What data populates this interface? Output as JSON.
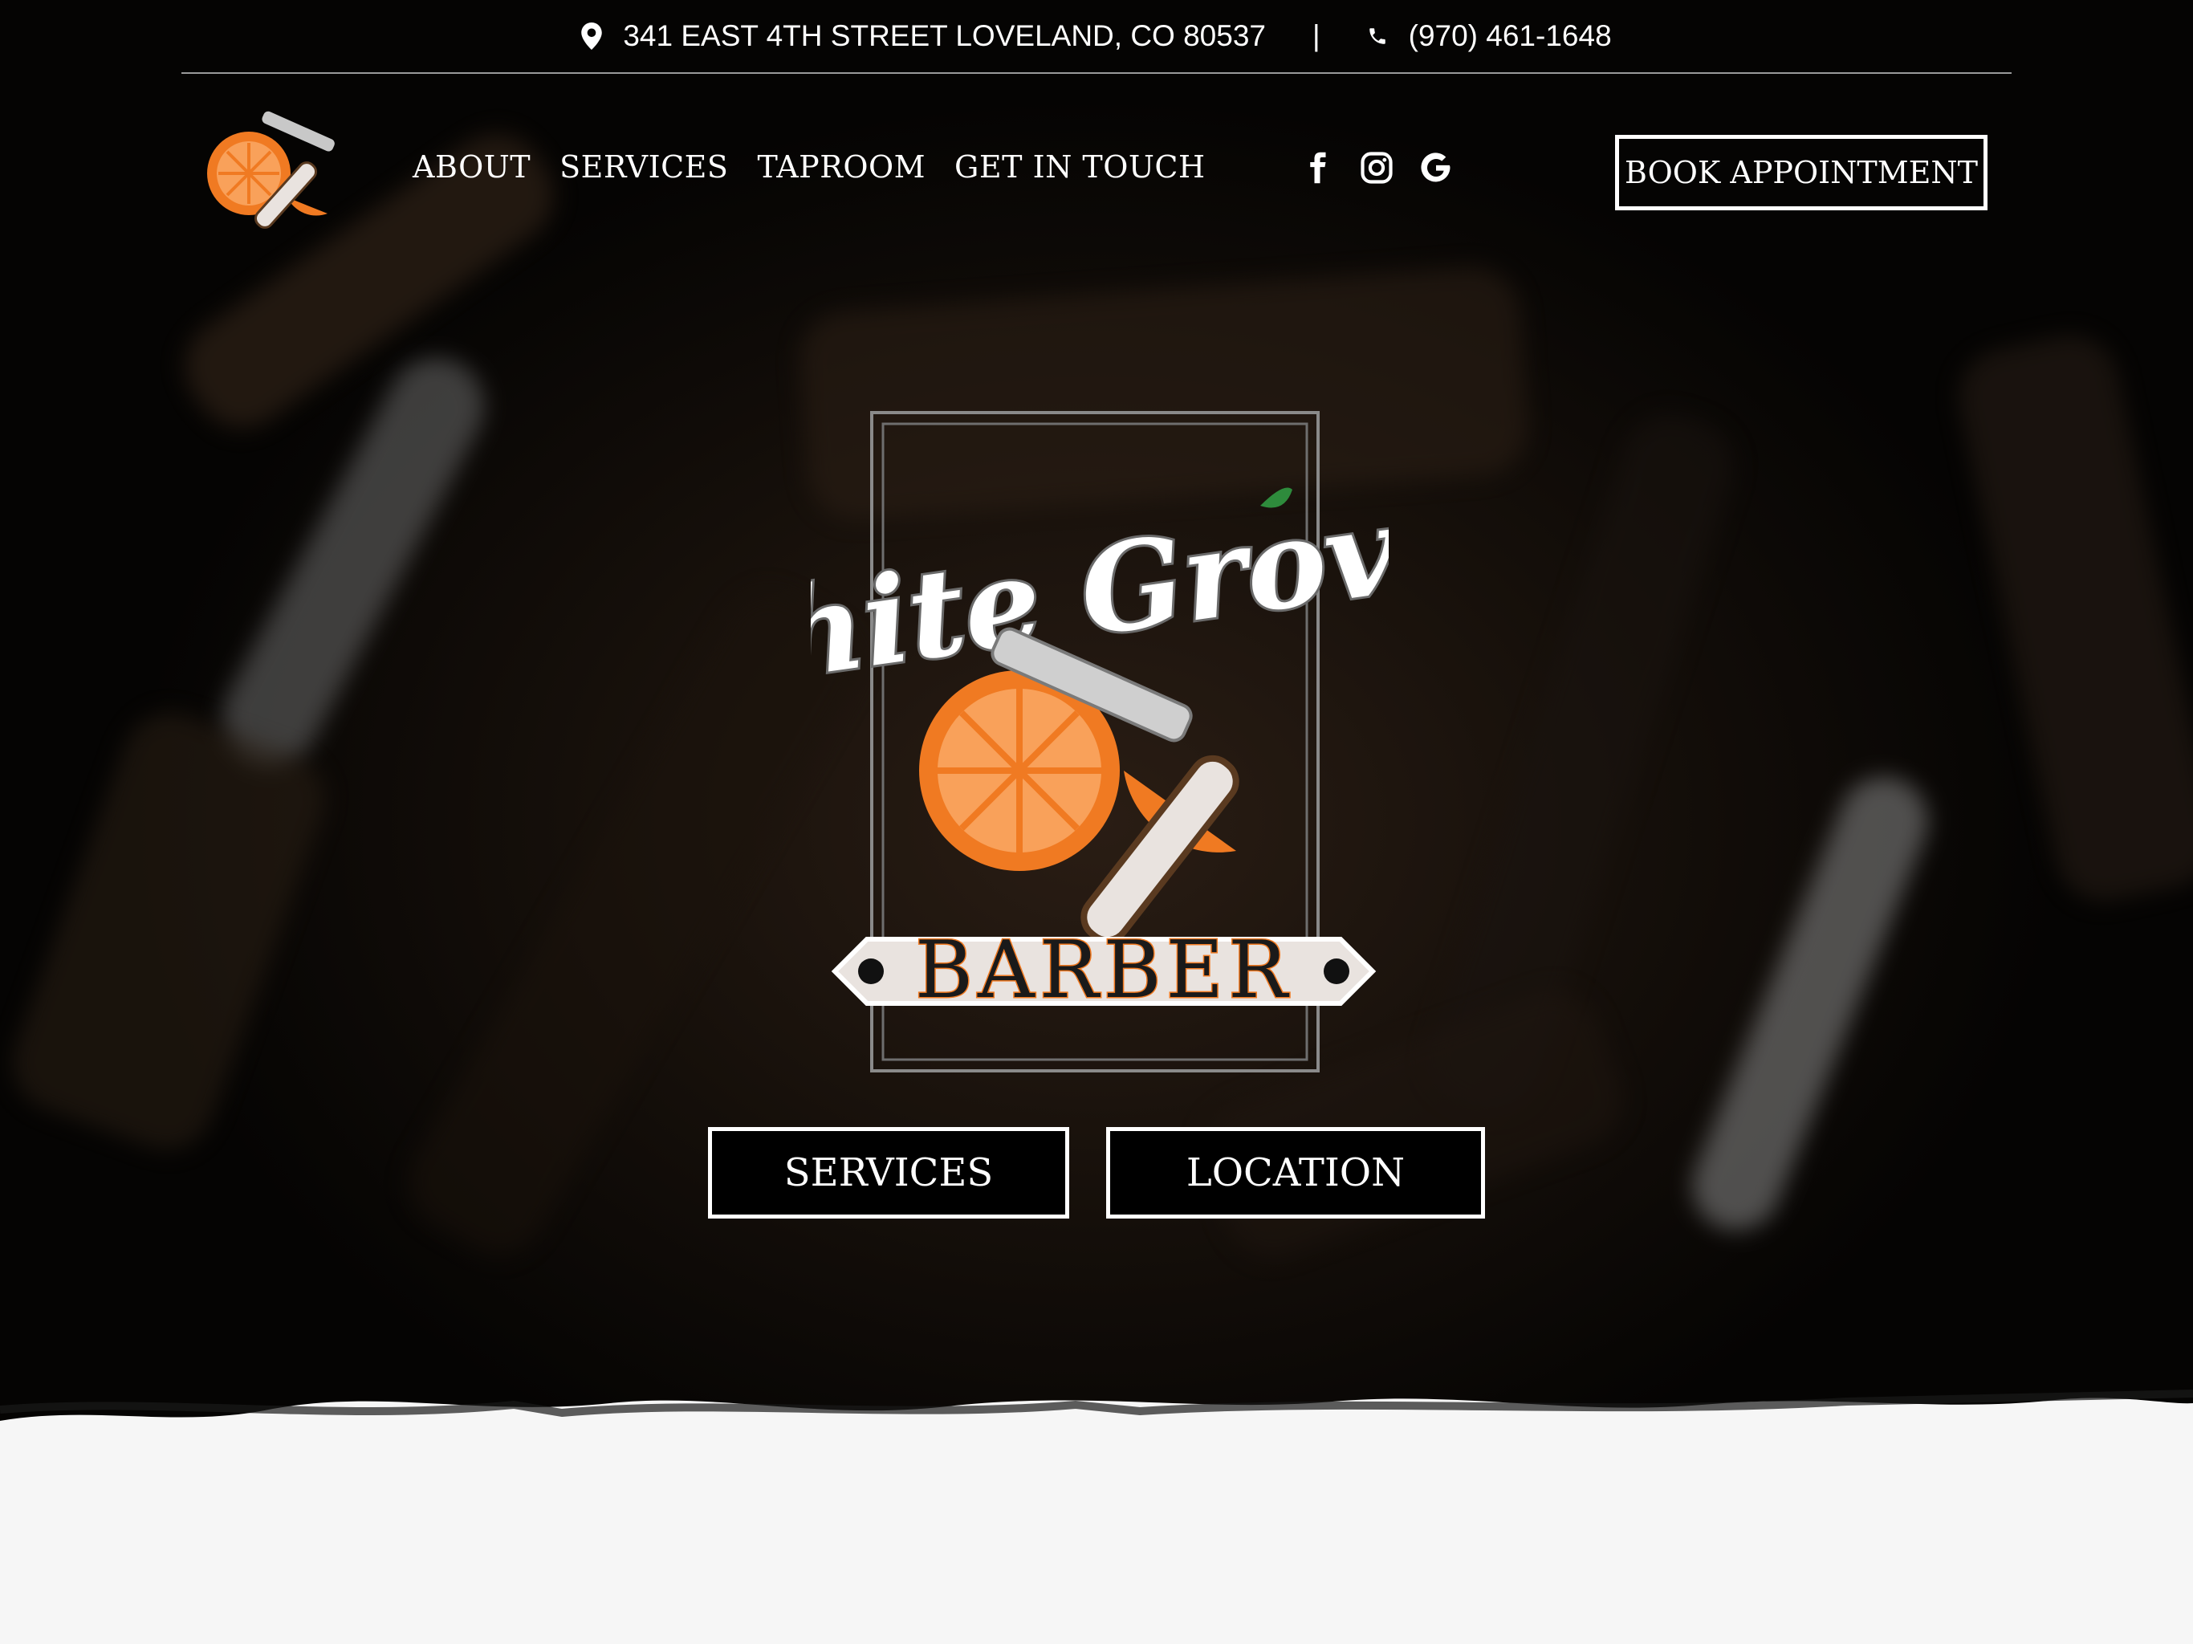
{
  "topbar": {
    "address": "341 EAST 4TH STREET LOVELAND, CO 80537",
    "separator": "|",
    "phone": "(970) 461-1648",
    "address_icon": "map-pin-icon",
    "phone_icon": "phone-icon"
  },
  "nav": {
    "items": [
      "ABOUT",
      "SERVICES",
      "TAPROOM",
      "GET IN TOUCH"
    ],
    "social_icons": [
      "facebook-icon",
      "instagram-icon",
      "google-icon"
    ],
    "book_label": "BOOK APPOINTMENT"
  },
  "hero": {
    "logo_script": "White Groves",
    "logo_banner": "BARBER",
    "buttons": [
      "SERVICES",
      "LOCATION"
    ]
  },
  "colors": {
    "background": "#000000",
    "orange": "#f07a22",
    "cream": "#e9e3df",
    "white": "#ffffff"
  }
}
